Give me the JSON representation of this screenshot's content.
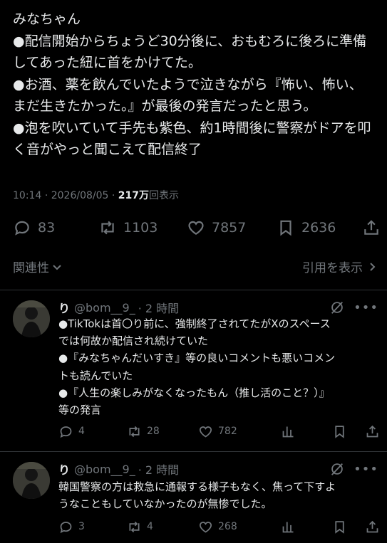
{
  "post": {
    "lines": [
      "みなちゃん",
      "●配信開始からちょうど30分後に、おもむろに後ろに準備",
      "してあった紐に首をかけてた。",
      "●お酒、薬を飲んでいたようで泣きながら『怖い、怖い、",
      "まだ生きたかった。』が最後の発言だったと思う。",
      "●泡を吹いていて手先も紫色、約1時間後に警察がドアを叩",
      "く音がやっと聞こえて配信終了"
    ],
    "time": "10:14",
    "date": "2026/08/05",
    "views_num": "217万",
    "views_label": "回表示",
    "separator": "·"
  },
  "actions": {
    "replies": "83",
    "reposts": "1103",
    "likes": "7857",
    "bookmarks": "2636"
  },
  "sort": {
    "left_label": "関連性",
    "right_label": "引用を表示"
  },
  "replies": [
    {
      "author": "り",
      "handle": "@bom__9_",
      "time": "· 2 時間",
      "lines": [
        "●TikTokは首〇り前に、強制終了されてたがXのスペース",
        "では何故か配信され続けていた",
        "●『みなちゃんだいすき』等の良いコメントも悪いコメン",
        "トも読んでいた",
        "●『人生の楽しみがなくなったもん（推し活のこと？）』",
        "等の発言"
      ],
      "replies": "4",
      "reposts": "28",
      "likes": "782"
    },
    {
      "author": "り",
      "handle": "@bom__9_",
      "time": "· 2 時間",
      "lines": [
        "韓国警察の方は救急に通報する様子もなく、焦って下すよ",
        "うなこともしていなかったのが無惨でした。"
      ],
      "replies": "3",
      "reposts": "4",
      "likes": "268"
    }
  ],
  "icons": {
    "reply": "comment-bubble-icon",
    "repost": "repost-arrows-icon",
    "like": "heart-icon",
    "bookmark": "bookmark-icon",
    "share": "share-upload-icon",
    "grok": "grok-slash-icon",
    "more": "more-dots-icon",
    "stats": "stats-bars-icon",
    "chevron": "chevron-icon"
  }
}
